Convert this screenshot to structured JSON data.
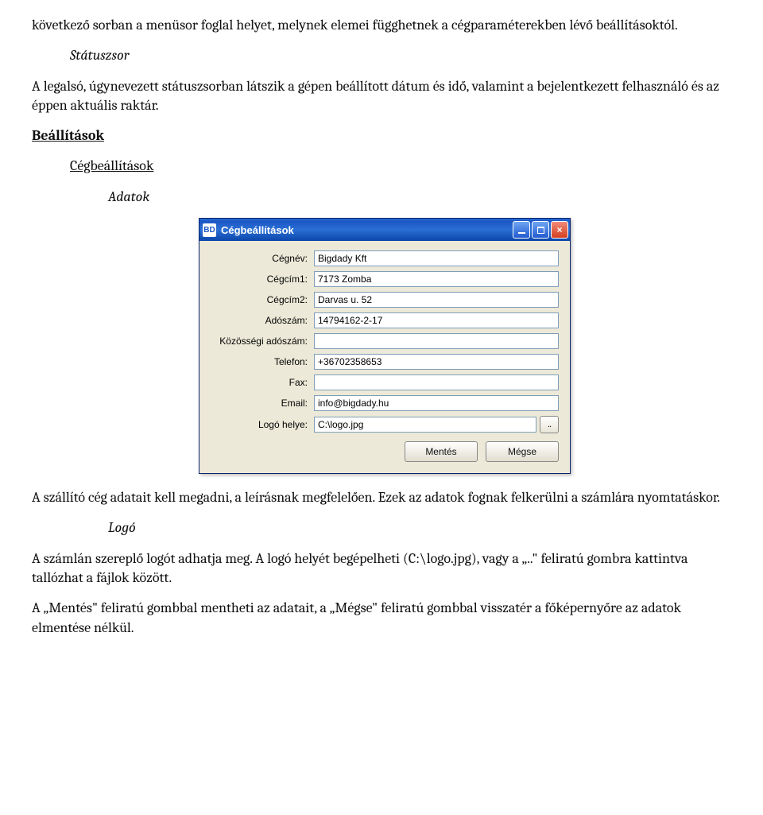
{
  "doc": {
    "p1": "következő sorban a menüsor foglal helyet, melynek elemei függhetnek a cégparaméterekben lévő beállításoktól.",
    "h_status": "Státuszsor",
    "p_status": "A legalsó, úgynevezett státuszsorban látszik a gépen beállított dátum és idő, valamint a bejelentkezett felhasználó és az éppen aktuális raktár.",
    "h_beall": "Beállítások",
    "h_ceg": "Cégbeállítások",
    "h_adatok": "Adatok",
    "p_after1": "A szállító cég adatait kell megadni, a leírásnak megfelelően. Ezek az adatok fognak felkerülni a számlára nyomtatáskor.",
    "h_logo": "Logó",
    "p_logo1": "A számlán szereplő logót adhatja meg. A logó helyét begépelheti (C:\\logo.jpg), vagy a „..\" feliratú gombra kattintva tallózhat a fájlok között.",
    "p_logo2": "A „Mentés\" feliratú gombbal mentheti az adatait, a „Mégse\" feliratú gombbal visszatér a főképernyőre az adatok elmentése nélkül."
  },
  "dialog": {
    "app_icon": "BD",
    "title": "Cégbeállítások",
    "labels": {
      "cegnev": "Cégnév:",
      "cegcim1": "Cégcím1:",
      "cegcim2": "Cégcím2:",
      "adoszam": "Adószám:",
      "kozadoszam": "Közösségi adószám:",
      "telefon": "Telefon:",
      "fax": "Fax:",
      "email": "Email:",
      "logo": "Logó helye:"
    },
    "values": {
      "cegnev": "Bigdady Kft",
      "cegcim1": "7173 Zomba",
      "cegcim2": "Darvas u. 52",
      "adoszam": "14794162-2-17",
      "kozadoszam": "",
      "telefon": "+36702358653",
      "fax": "",
      "email": "info@bigdady.hu",
      "logo": "C:\\logo.jpg"
    },
    "browse_label": "..",
    "save_label": "Mentés",
    "cancel_label": "Mégse"
  }
}
